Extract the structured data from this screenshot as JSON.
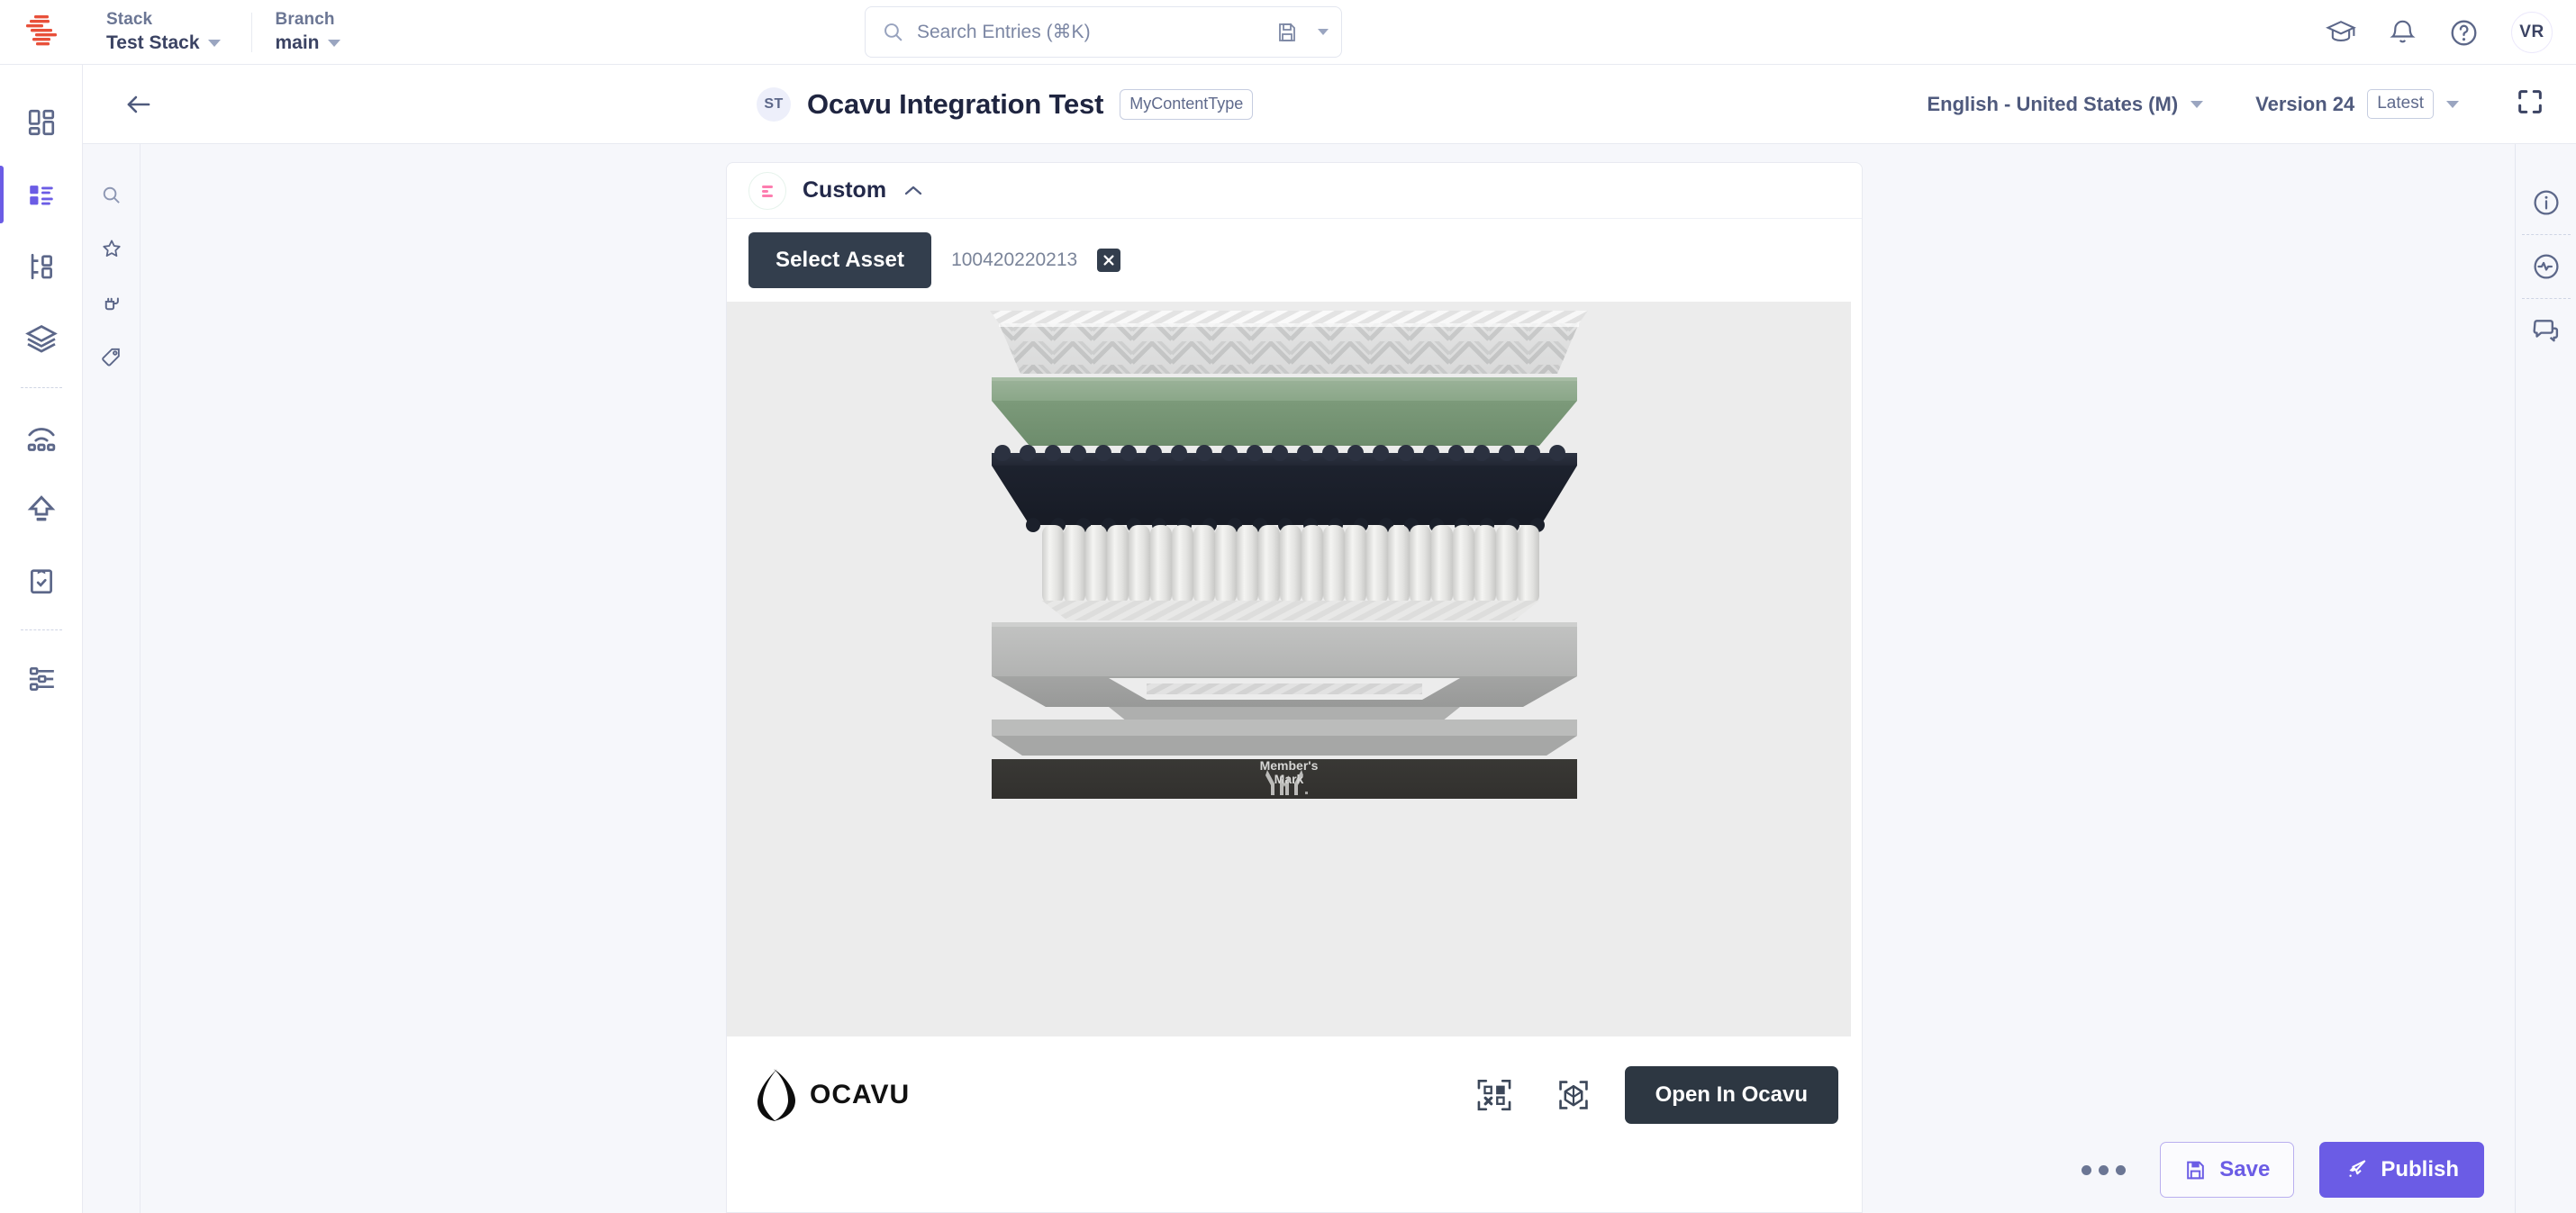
{
  "topbar": {
    "logo_icon": "contentstack-logo-icon",
    "stack": {
      "label": "Stack",
      "value": "Test Stack"
    },
    "branch": {
      "label": "Branch",
      "value": "main"
    },
    "search": {
      "placeholder": "Search Entries (⌘K)",
      "icon": "search-icon",
      "save_icon": "save-search-icon",
      "caret_icon": "chevron-down-icon"
    },
    "actions": [
      {
        "name": "academy-icon",
        "icon": "graduation-cap-icon"
      },
      {
        "name": "notifications-icon",
        "icon": "bell-icon"
      },
      {
        "name": "help-icon",
        "icon": "question-circle-icon"
      }
    ],
    "avatar": "VR"
  },
  "main_rail": [
    {
      "name": "sidebar-item-dashboard",
      "icon": "dashboard-grid-icon",
      "active": false
    },
    {
      "name": "sidebar-item-entries",
      "icon": "entries-list-icon",
      "active": true
    },
    {
      "name": "sidebar-item-content-types",
      "icon": "content-type-tree-icon",
      "active": false
    },
    {
      "name": "sidebar-item-assets",
      "icon": "layers-stack-icon",
      "active": false
    },
    {
      "name": "sidebar-item-live-preview",
      "icon": "broadcast-icon",
      "active": false
    },
    {
      "name": "sidebar-item-releases",
      "icon": "upload-arrow-icon",
      "active": false
    },
    {
      "name": "sidebar-item-tasks",
      "icon": "clipboard-check-icon",
      "active": false
    },
    {
      "name": "sidebar-item-settings",
      "icon": "sliders-settings-icon",
      "active": false
    }
  ],
  "sub_rail": [
    {
      "name": "subrail-search",
      "icon": "search-icon"
    },
    {
      "name": "subrail-favorites",
      "icon": "star-icon"
    },
    {
      "name": "subrail-extensions",
      "icon": "plug-icon"
    },
    {
      "name": "subrail-labels",
      "icon": "tag-icon"
    }
  ],
  "entry_header": {
    "back_icon": "arrow-left-icon",
    "stack_initials": "ST",
    "title": "Ocavu Integration Test",
    "content_type": "MyContentType",
    "locale": "English - United States (M)",
    "version": "Version 24",
    "version_tag": "Latest",
    "expand_icon": "fullscreen-expand-icon"
  },
  "right_rail": [
    {
      "name": "rightrail-info",
      "icon": "info-circle-icon"
    },
    {
      "name": "rightrail-activity",
      "icon": "activity-pulse-icon"
    },
    {
      "name": "rightrail-comments",
      "icon": "comments-icon"
    }
  ],
  "field": {
    "icon": "custom-field-lines-icon",
    "name": "Custom",
    "collapse_icon": "chevron-up-icon",
    "select_asset_label": "Select Asset",
    "asset_id": "100420220213",
    "clear_icon": "close-x-icon"
  },
  "viewer": {
    "background_color": "#ececec",
    "brand_logo": "ocavu-diamond-icon",
    "brand_name": "OCAVU",
    "qr_icon": "qr-code-scan-icon",
    "ar_icon": "ar-cube-icon",
    "open_label": "Open In Ocavu",
    "product_brand_line1": "Member's",
    "product_brand_line2": "Mark",
    "product_brand_logo": "members-mark-m-icon",
    "layers": [
      {
        "name": "quilted-cover",
        "color": "#c9cbca"
      },
      {
        "name": "green-comfort-foam",
        "color": "#8ba789"
      },
      {
        "name": "dark-support-foam",
        "color": "#252a38"
      },
      {
        "name": "pocketed-coil-unit",
        "color": "#e4e4e2"
      },
      {
        "name": "base-foam",
        "color": "#b4b5b4"
      },
      {
        "name": "edge-support-frame",
        "color": "#a9aaa9"
      },
      {
        "name": "base-panel",
        "color": "#b8b9b8"
      },
      {
        "name": "foundation-box",
        "color": "#33322f"
      }
    ]
  },
  "action_bar": {
    "more_icon": "more-dots-icon",
    "save_label": "Save",
    "save_icon": "floppy-disk-icon",
    "publish_label": "Publish",
    "publish_icon": "rocket-icon",
    "accent_color": "#6b5ce5"
  }
}
